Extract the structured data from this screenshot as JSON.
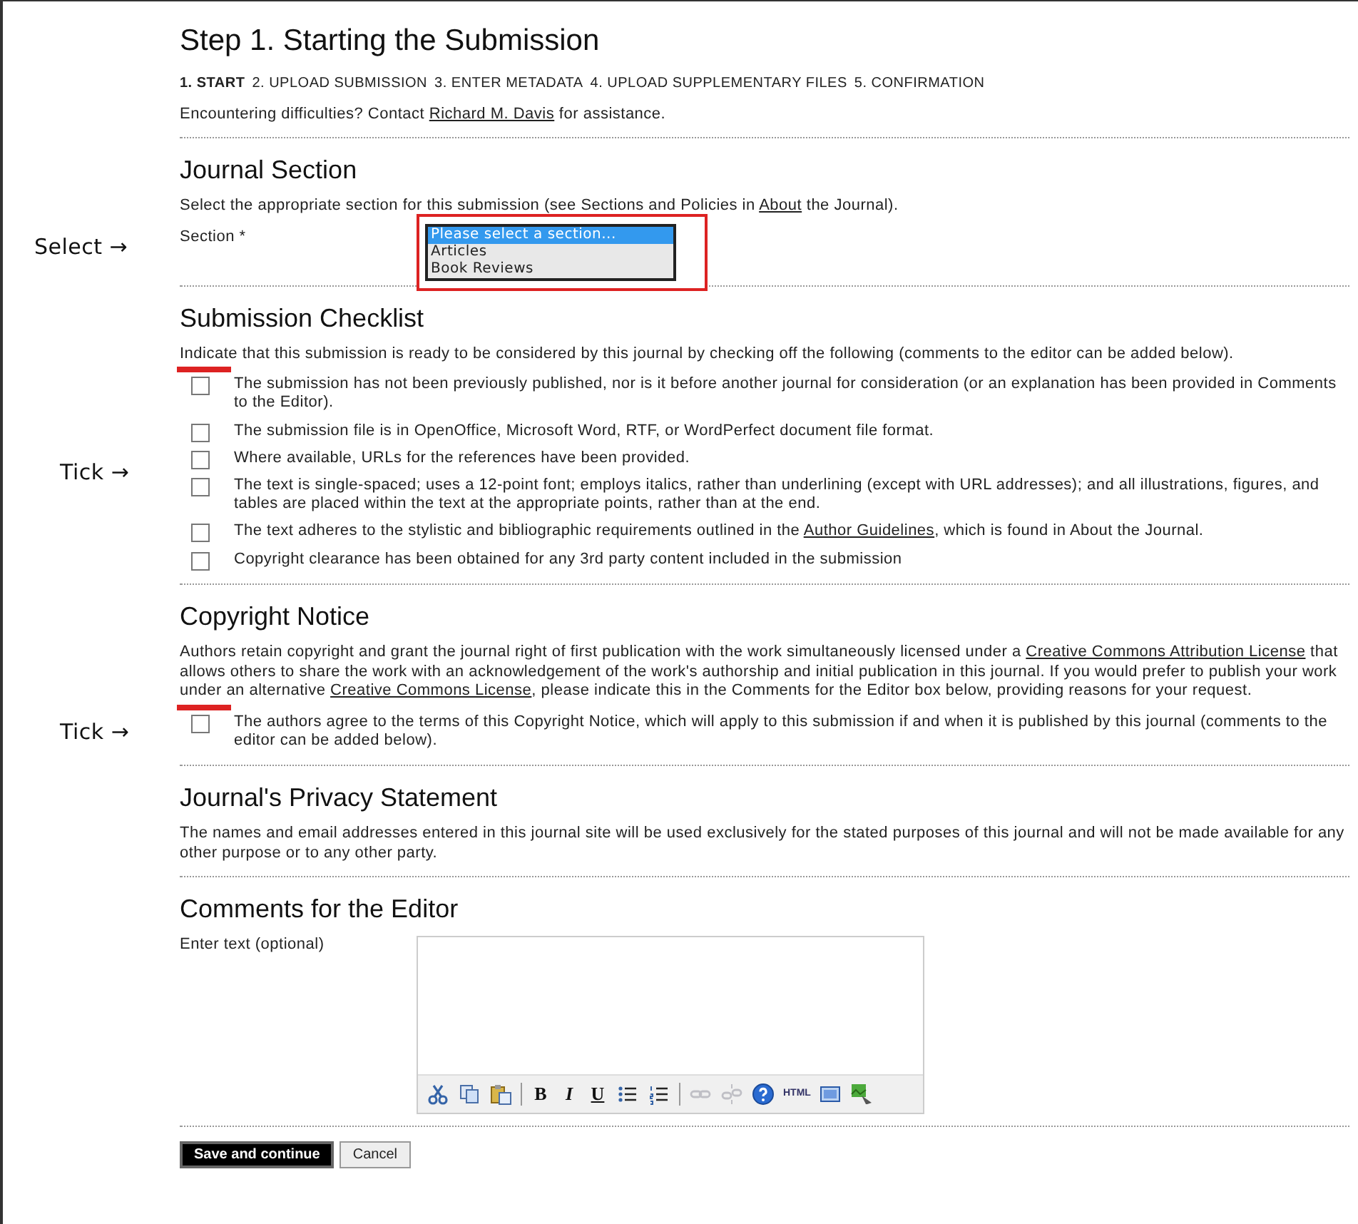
{
  "title": "Step 1. Starting the Submission",
  "steps": [
    {
      "label": "1. START",
      "selected": true
    },
    {
      "label": "2. UPLOAD SUBMISSION",
      "selected": false
    },
    {
      "label": "3. ENTER METADATA",
      "selected": false
    },
    {
      "label": "4. UPLOAD SUPPLEMENTARY FILES",
      "selected": false
    },
    {
      "label": "5. CONFIRMATION",
      "selected": false
    }
  ],
  "help_text": [
    {
      "text": "Encountering difficulties? Contact ",
      "link": false
    },
    {
      "text": "Richard M. Davis",
      "link": true
    },
    {
      "text": " for assistance.",
      "link": false
    }
  ],
  "journal_section": {
    "heading": "Journal Section",
    "description": [
      {
        "text": "Select the appropriate section for this submission (see Sections and Policies in ",
        "link": false
      },
      {
        "text": "About",
        "link": true
      },
      {
        "text": " the Journal).",
        "link": false
      }
    ],
    "annotation": "Select →",
    "field_label": "Section *",
    "options": [
      {
        "label": "Please select a section...",
        "selected": true
      },
      {
        "label": "Articles",
        "selected": false
      },
      {
        "label": "Book Reviews",
        "selected": false
      }
    ]
  },
  "checklist": {
    "heading": "Submission Checklist",
    "intro": "Indicate that this submission is ready to be considered by this journal by checking off the following (comments to the editor can be added below).",
    "annotation": "Tick →",
    "items": [
      {
        "checked": false,
        "text": [
          {
            "text": "The submission has not been previously published, nor is it before another journal for consideration (or an explanation has been provided in Comments to the Editor).",
            "link": false
          }
        ]
      },
      {
        "checked": false,
        "text": [
          {
            "text": "The submission file is in OpenOffice, Microsoft Word, RTF, or WordPerfect document file format.",
            "link": false
          }
        ]
      },
      {
        "checked": false,
        "text": [
          {
            "text": "Where available, URLs for the references have been provided.",
            "link": false
          }
        ]
      },
      {
        "checked": false,
        "text": [
          {
            "text": "The text is single-spaced; uses a 12-point font; employs italics, rather than underlining (except with URL addresses); and all illustrations, figures, and tables are placed within the text at the appropriate points, rather than at the end.",
            "link": false
          }
        ]
      },
      {
        "checked": false,
        "text": [
          {
            "text": "The text adheres to the stylistic and bibliographic requirements outlined in the ",
            "link": false
          },
          {
            "text": "Author Guidelines",
            "link": true
          },
          {
            "text": ", which is found in About the Journal.",
            "link": false
          }
        ]
      },
      {
        "checked": false,
        "text": [
          {
            "text": "Copyright clearance has been obtained for any 3rd party content included in the submission",
            "link": false
          }
        ]
      }
    ]
  },
  "copyright": {
    "heading": "Copyright Notice",
    "text": [
      {
        "text": "Authors retain copyright and grant the journal right of first publication with the work simultaneously licensed under a ",
        "link": false
      },
      {
        "text": "Creative Commons Attribution License",
        "link": true
      },
      {
        "text": " that allows others to share the work with an acknowledgement of the work's authorship and initial publication in this journal. If you would prefer to publish your work under an alternative ",
        "link": false
      },
      {
        "text": "Creative Commons License",
        "link": true
      },
      {
        "text": ", please indicate this in the Comments for the Editor box below, providing reasons for your request.",
        "link": false
      }
    ],
    "annotation": "Tick →",
    "items": [
      {
        "checked": false,
        "text": [
          {
            "text": "The authors agree to the terms of this Copyright Notice, which will apply to this submission if and when it is published by this journal (comments to the editor can be added below).",
            "link": false
          }
        ]
      }
    ]
  },
  "privacy": {
    "heading": "Journal's Privacy Statement",
    "text": "The names and email addresses entered in this journal site will be used exclusively for the stated purposes of this journal and will not be made available for any other purpose or to any other party."
  },
  "comments": {
    "heading": "Comments for the Editor",
    "label": "Enter text (optional)",
    "toolbar": [
      {
        "kind": "cut",
        "disabled": false
      },
      {
        "kind": "copy",
        "disabled": false
      },
      {
        "kind": "paste",
        "disabled": false
      },
      {
        "kind": "separator",
        "disabled": false
      },
      {
        "kind": "bold",
        "label": "B",
        "disabled": false
      },
      {
        "kind": "italic",
        "label": "I",
        "disabled": false
      },
      {
        "kind": "underline",
        "label": "U",
        "disabled": false
      },
      {
        "kind": "bullets",
        "disabled": false
      },
      {
        "kind": "numbered",
        "disabled": false
      },
      {
        "kind": "separator",
        "disabled": false
      },
      {
        "kind": "link",
        "disabled": true
      },
      {
        "kind": "unlink",
        "disabled": true
      },
      {
        "kind": "help",
        "disabled": false
      },
      {
        "kind": "html",
        "label": "HTML",
        "disabled": false
      },
      {
        "kind": "fullscreen",
        "disabled": false
      },
      {
        "kind": "image",
        "disabled": false
      }
    ]
  },
  "buttons": [
    {
      "label": "Save and continue",
      "primary": true
    },
    {
      "label": "Cancel",
      "primary": false
    }
  ]
}
